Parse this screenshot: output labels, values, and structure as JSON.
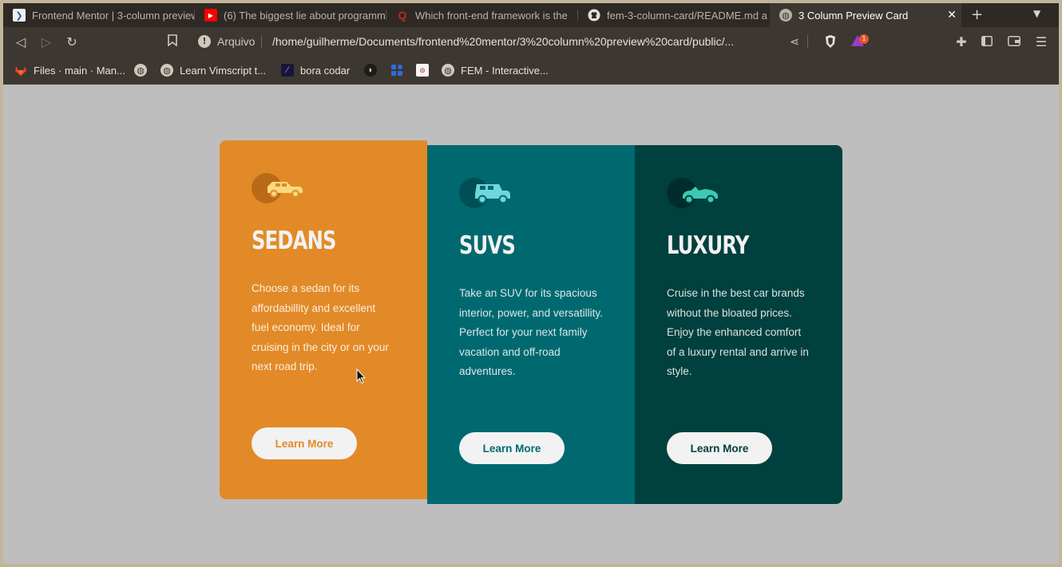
{
  "browser": {
    "tabs": [
      {
        "title": "Frontend Mentor | 3-column preview",
        "icon": "frontend-mentor-icon"
      },
      {
        "title": "(6) The biggest lie about programming",
        "icon": "youtube-icon"
      },
      {
        "title": "Which front-end framework is the",
        "icon": "quora-icon"
      },
      {
        "title": "fem-3-column-card/README.md a",
        "icon": "github-icon"
      },
      {
        "title": "3 Column Preview Card",
        "icon": "globe-icon"
      }
    ],
    "address": {
      "scheme_label": "Arquivo",
      "url": "/home/guilherme/Documents/frontend%20mentor/3%20column%20preview%20card/public/..."
    },
    "notification_count": "1",
    "bookmarks": [
      {
        "label": "Files · main · Man...",
        "icon": "gitlab-icon"
      },
      {
        "label": "",
        "icon": "globe-icon"
      },
      {
        "label": "Learn Vimscript t...",
        "icon": "globe-icon"
      },
      {
        "label": "bora codar",
        "icon": "bora-codar-icon"
      },
      {
        "label": "",
        "icon": "shield-icon"
      },
      {
        "label": "",
        "icon": "apps-icon"
      },
      {
        "label": "",
        "icon": "bookmark-site-icon"
      },
      {
        "label": "FEM - Interactive...",
        "icon": "globe-icon"
      }
    ]
  },
  "cards": [
    {
      "id": "sedans",
      "title": "SEDANS",
      "text": "Choose a sedan for its affordabillity and excellent fuel economy. Ideal for cruising in the city or on your next road trip.",
      "button": "Learn More",
      "icon": "sedan-icon",
      "color": "#e28a27"
    },
    {
      "id": "suvs",
      "title": "SUVS",
      "text": "Take an SUV for its spacious interior, power, and versatillity. Perfect for your next family vacation and off-road adventures.",
      "button": "Learn More",
      "icon": "suv-icon",
      "color": "#006970"
    },
    {
      "id": "luxury",
      "title": "LUXURY",
      "text": "Cruise in the best car brands without the bloated prices. Enjoy the enhanced comfort of a luxury rental and arrive in style.",
      "button": "Learn More",
      "icon": "luxury-car-icon",
      "color": "#00403e"
    }
  ]
}
